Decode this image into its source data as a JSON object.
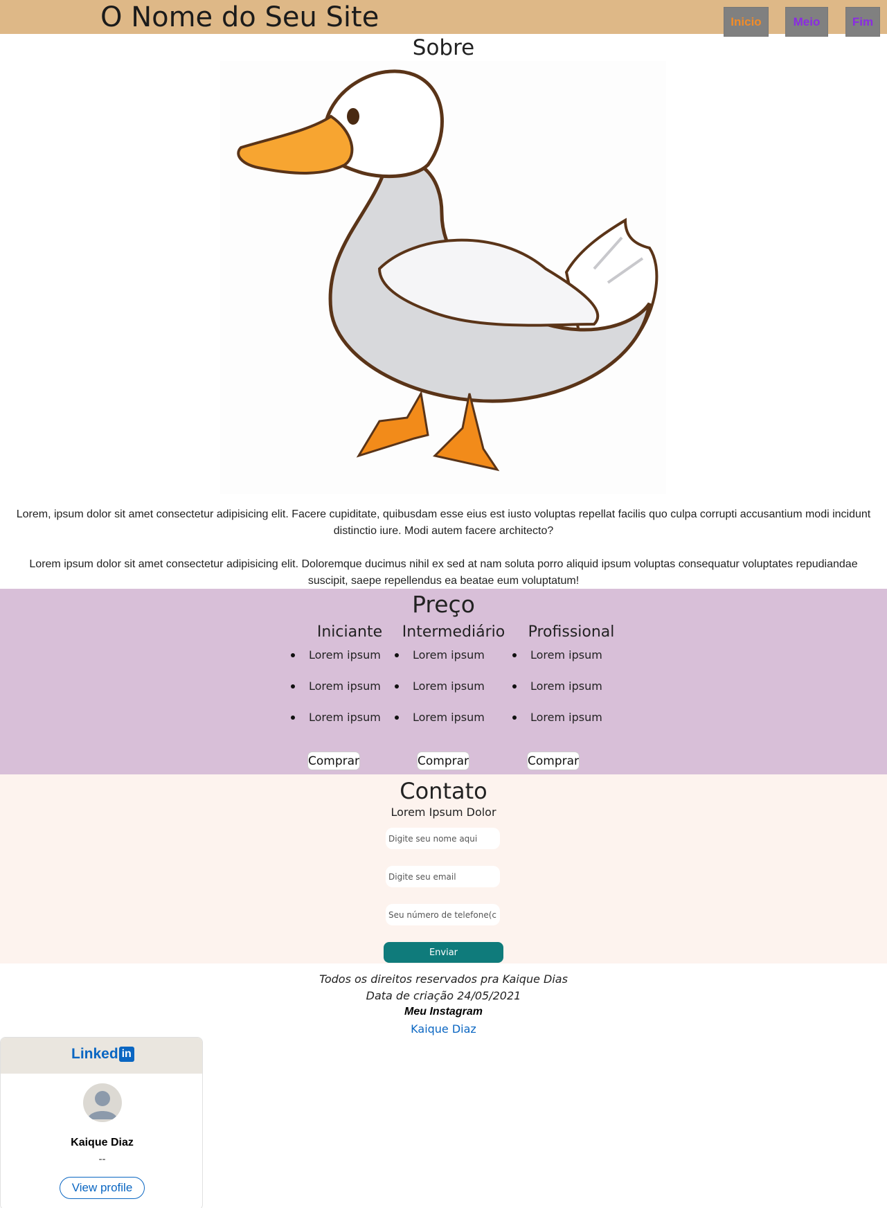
{
  "header": {
    "site_title": "O Nome do Seu Site",
    "nav": [
      "Inicio",
      "Meio",
      "Fim"
    ]
  },
  "sobre": {
    "title": "Sobre",
    "image": "duck-illustration",
    "paragraph1": "Lorem, ipsum dolor sit amet consectetur adipisicing elit. Facere cupiditate, quibusdam esse eius est iusto voluptas repellat facilis quo culpa corrupti accusantium modi incidunt distinctio iure. Modi autem facere architecto?",
    "paragraph2": "Lorem ipsum dolor sit amet consectetur adipisicing elit. Doloremque ducimus nihil ex sed at nam soluta porro aliquid ipsum voluptas consequatur voluptates repudiandae suscipit, saepe repellendus ea beatae eum voluptatum!"
  },
  "preco": {
    "title": "Preço",
    "plans": [
      {
        "name": "Iniciante",
        "items": [
          "Lorem ipsum",
          "Lorem ipsum",
          "Lorem ipsum"
        ],
        "button": "Comprar"
      },
      {
        "name": "Intermediário",
        "items": [
          "Lorem ipsum",
          "Lorem ipsum",
          "Lorem ipsum"
        ],
        "button": "Comprar"
      },
      {
        "name": "Profissional",
        "items": [
          "Lorem ipsum",
          "Lorem ipsum",
          "Lorem ipsum"
        ],
        "button": "Comprar"
      }
    ]
  },
  "contato": {
    "title": "Contato",
    "subtitle": "Lorem Ipsum Dolor",
    "name_placeholder": "Digite seu nome aqui",
    "email_placeholder": "Digite seu email",
    "phone_placeholder": "Seu número de telefone(c",
    "send_label": "Enviar"
  },
  "footer": {
    "rights": "Todos os direitos reservados pra Kaique Dias",
    "date": "Data de criação 24/05/2021",
    "instagram_label": "Meu Instagram",
    "instagram_link": "Kaique Diaz"
  },
  "linkedin": {
    "brand_word": "Linked",
    "brand_box": "in",
    "name": "Kaique Diaz",
    "headline": "--",
    "button": "View profile"
  },
  "colors": {
    "header_bg": "#deb887",
    "pricing_bg": "#d8bfd8",
    "contact_bg": "#fdf3ee",
    "send_button": "#0f7b7b",
    "link_blue": "#0a66c2"
  }
}
